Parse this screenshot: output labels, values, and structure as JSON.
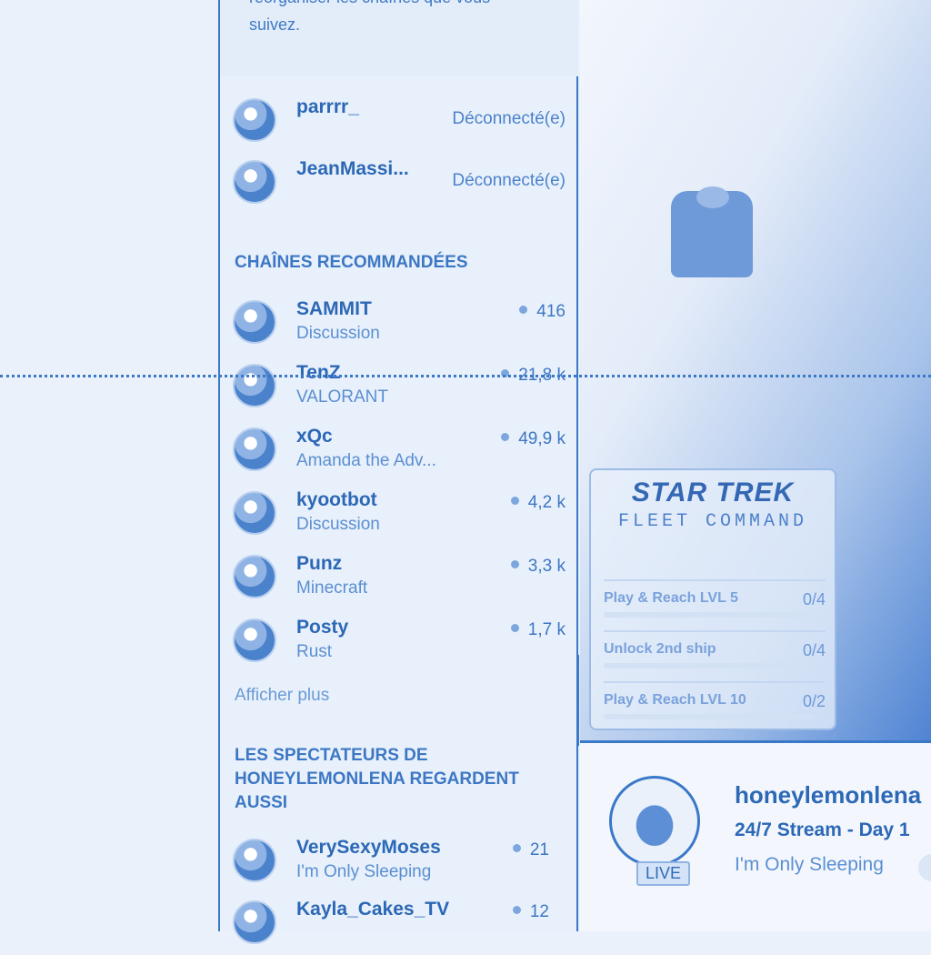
{
  "sidebar": {
    "help_text": "réorganiser les chaînes que vous suivez.",
    "followed": [
      {
        "name": "parrrr_",
        "status": "Déconnecté(e)"
      },
      {
        "name": "JeanMassi...",
        "status": "Déconnecté(e)"
      }
    ],
    "recommended_title": "CHAÎNES RECOMMANDÉES",
    "recommended": [
      {
        "name": "SAMMIT",
        "category": "Discussion",
        "viewers": "416"
      },
      {
        "name": "TenZ",
        "category": "VALORANT",
        "viewers": "21,8 k"
      },
      {
        "name": "xQc",
        "category": "Amanda the Adv...",
        "viewers": "49,9 k"
      },
      {
        "name": "kyootbot",
        "category": "Discussion",
        "viewers": "4,2 k"
      },
      {
        "name": "Punz",
        "category": "Minecraft",
        "viewers": "3,3 k"
      },
      {
        "name": "Posty",
        "category": "Rust",
        "viewers": "1,7 k"
      }
    ],
    "show_more": "Afficher plus",
    "also_watch_title": "LES SPECTATEURS DE HONEYLEMONLENA REGARDENT AUSSI",
    "also_watch": [
      {
        "name": "VerySexyMoses",
        "category": "I'm Only Sleeping",
        "viewers": "21"
      },
      {
        "name": "Kayla_Cakes_TV",
        "category": "",
        "viewers": "12"
      }
    ]
  },
  "ad": {
    "logo": "STAR TREK",
    "subtitle": "FLEET COMMAND",
    "tasks": [
      {
        "label": "Play & Reach LVL 5",
        "progress": "0/4"
      },
      {
        "label": "Unlock 2nd ship",
        "progress": "0/4"
      },
      {
        "label": "Play & Reach LVL 10",
        "progress": "0/2"
      }
    ]
  },
  "channel": {
    "name": "honeylemonlena",
    "title": "24/7 Stream - Day 1",
    "game": "I'm Only Sleeping",
    "live_label": "LIVE"
  },
  "colors": {
    "accent": "#3a78c8",
    "background": "#eaf1fb"
  }
}
